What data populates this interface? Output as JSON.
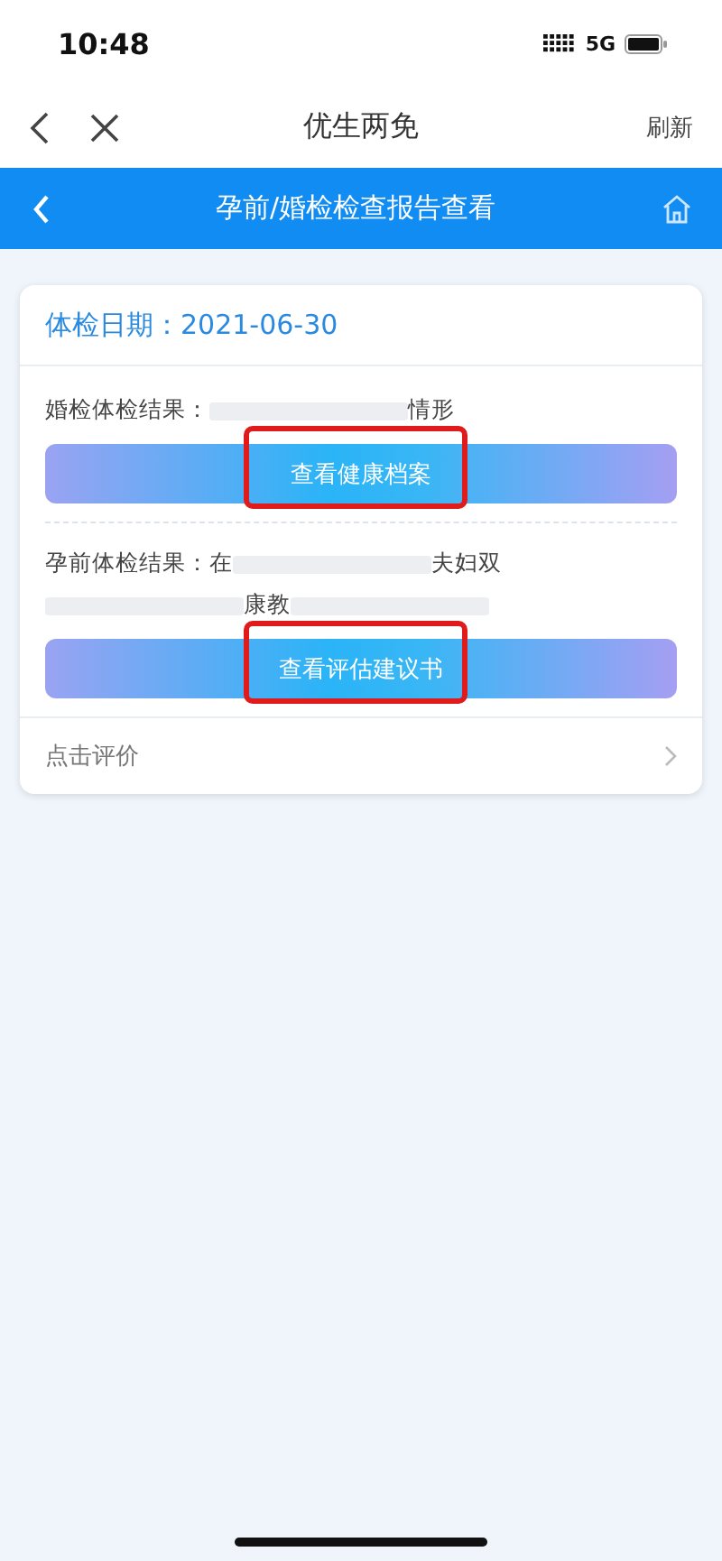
{
  "status_bar": {
    "time": "10:48",
    "network": "5G"
  },
  "nav_bar": {
    "title": "优生两免",
    "action": "刷新"
  },
  "header": {
    "title": "孕前/婚检检查报告查看"
  },
  "card": {
    "date_label": "体检日期：",
    "date": "2021-06-30",
    "sections": [
      {
        "segments": [
          {
            "kind": "text",
            "text": "婚检体检结果："
          },
          {
            "kind": "redacted"
          },
          {
            "kind": "text",
            "text": "情形"
          }
        ],
        "button": {
          "label": "查看健康档案",
          "highlighted": true
        }
      },
      {
        "segments": [
          {
            "kind": "text",
            "text": "孕前体检结果：在"
          },
          {
            "kind": "redacted"
          },
          {
            "kind": "text",
            "text": "夫妇双"
          },
          {
            "kind": "redacted"
          },
          {
            "kind": "text",
            "text": "康教"
          },
          {
            "kind": "redacted"
          }
        ],
        "button": {
          "label": "查看评估建议书",
          "highlighted": true
        }
      }
    ],
    "footer": "点击评价"
  }
}
